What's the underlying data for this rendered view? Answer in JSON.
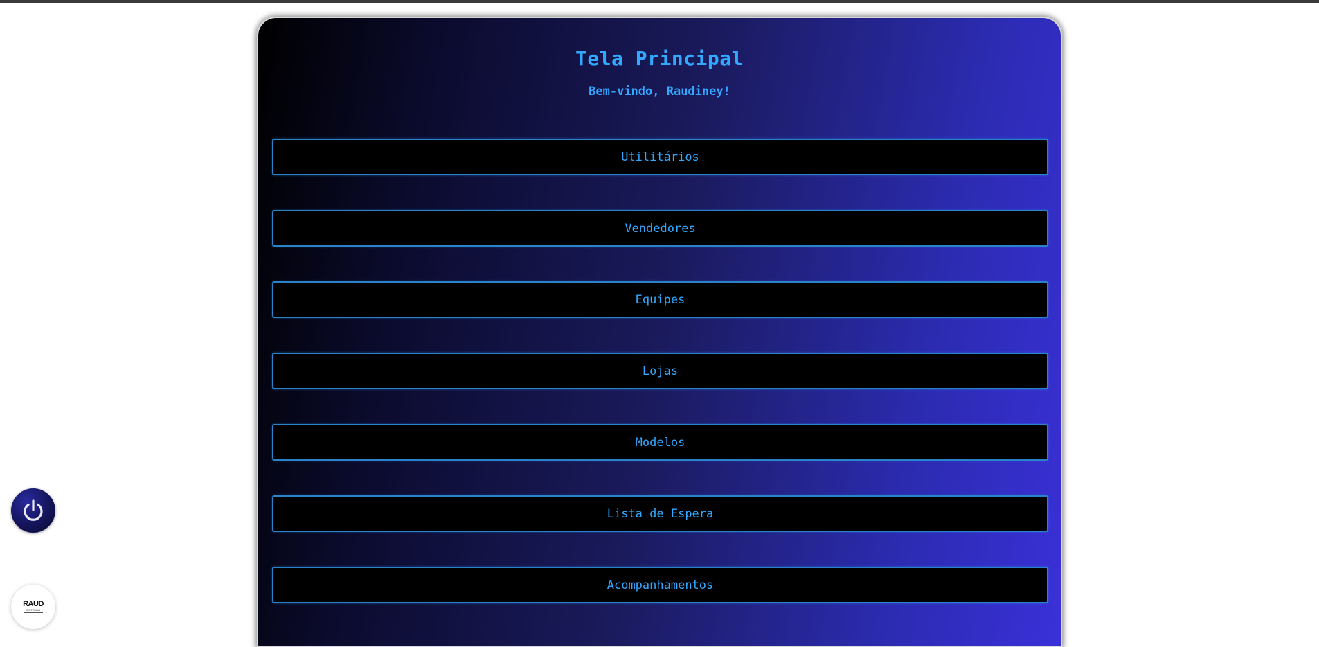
{
  "header": {
    "title": "Tela Principal",
    "welcome": "Bem-vindo, Raudiney!"
  },
  "menu": [
    {
      "label": "Utilitários"
    },
    {
      "label": "Vendedores"
    },
    {
      "label": "Equipes"
    },
    {
      "label": "Lojas"
    },
    {
      "label": "Modelos"
    },
    {
      "label": "Lista de Espera"
    },
    {
      "label": "Acompanhamentos"
    }
  ],
  "floating": {
    "power_icon": "power-icon",
    "logo_text": "RAUD",
    "logo_subtext": "SISTEMAS"
  },
  "colors": {
    "accent": "#33a8ff",
    "button_bg": "#000000",
    "button_border": "#2a83c9",
    "gradient_end": "#3a30d8"
  }
}
